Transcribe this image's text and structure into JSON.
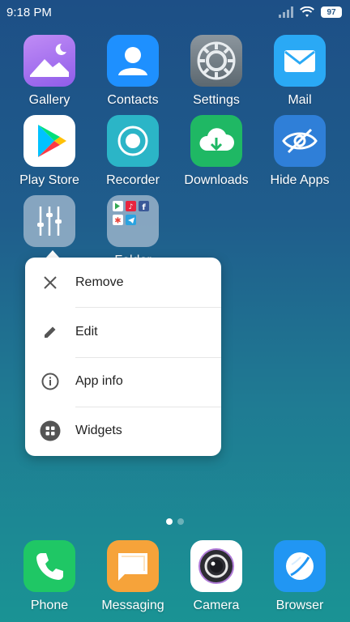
{
  "status_bar": {
    "time": "9:18 PM",
    "battery": "97",
    "icons": [
      "signal-icon",
      "wifi-icon",
      "battery-icon"
    ]
  },
  "apps": [
    {
      "label": "Gallery",
      "icon": "gallery-icon",
      "color": "#b46fe8"
    },
    {
      "label": "Contacts",
      "icon": "contacts-icon",
      "color": "#1e90ff"
    },
    {
      "label": "Settings",
      "icon": "settings-icon",
      "color": "#6f7c86"
    },
    {
      "label": "Mail",
      "icon": "mail-icon",
      "color": "#2aa9f5"
    },
    {
      "label": "Play Store",
      "icon": "play-store-icon",
      "color": "#ffffff"
    },
    {
      "label": "Recorder",
      "icon": "recorder-icon",
      "color": "#2bb5c7"
    },
    {
      "label": "Downloads",
      "icon": "downloads-icon",
      "color": "#1fb864"
    },
    {
      "label": "Hide Apps",
      "icon": "hide-apps-icon",
      "color": "#2f7fd8"
    },
    {
      "label": "",
      "icon": "equalizer-icon",
      "color": "#8fa7bd"
    },
    {
      "label": "Folder",
      "icon": "folder-icon",
      "color": "#8fa7bd"
    }
  ],
  "context_menu": {
    "items": [
      {
        "label": "Remove",
        "icon": "close-icon"
      },
      {
        "label": "Edit",
        "icon": "pencil-icon"
      },
      {
        "label": "App info",
        "icon": "info-icon"
      },
      {
        "label": "Widgets",
        "icon": "widgets-icon"
      }
    ]
  },
  "page_indicator": {
    "count": 2,
    "active": 1
  },
  "dock": [
    {
      "label": "Phone",
      "icon": "phone-icon",
      "color": "#1fc765"
    },
    {
      "label": "Messaging",
      "icon": "messaging-icon",
      "color": "#f6a33a"
    },
    {
      "label": "Camera",
      "icon": "camera-icon",
      "color": "#ffffff"
    },
    {
      "label": "Browser",
      "icon": "browser-icon",
      "color": "#2196f3"
    }
  ]
}
